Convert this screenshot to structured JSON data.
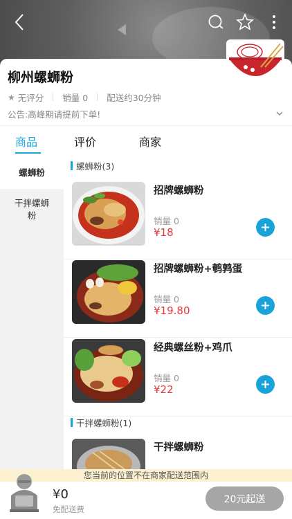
{
  "shop": {
    "name": "柳州螺蛳粉",
    "rating": "无评分",
    "sales": "销量 0",
    "delivery_time": "配送约30分钟",
    "notice": "公告:高峰期请提前下单!"
  },
  "tabs": [
    {
      "label": "商品",
      "active": true
    },
    {
      "label": "评价",
      "active": false
    },
    {
      "label": "商家",
      "active": false
    }
  ],
  "sidebar": {
    "items": [
      {
        "label": "螺蛳粉",
        "active": true
      },
      {
        "label": "干拌螺蛳粉",
        "active": false
      }
    ]
  },
  "sections": [
    {
      "title": "螺蛳粉(3)",
      "products": [
        {
          "name": "招牌螺蛳粉",
          "sales": "销量 0",
          "price": "¥18"
        },
        {
          "name": "招牌螺蛳粉+鹌鹑蛋",
          "sales": "销量 0",
          "price": "¥19.80"
        },
        {
          "name": "经典螺丝粉+鸡爪",
          "sales": "销量 0",
          "price": "¥22"
        }
      ]
    },
    {
      "title": "干拌螺蛳粉(1)",
      "products": [
        {
          "name": "干拌螺蛳粉"
        }
      ]
    }
  ],
  "banner": {
    "text": "您当前的位置不在商家配送范围内"
  },
  "cart": {
    "total": "¥0",
    "delivery_fee": "免配送费",
    "min_order": "20元起送"
  },
  "colors": {
    "accent": "#1aa3d9",
    "price": "#e4393c",
    "banner_bg": "#fbf0cf",
    "disabled_button": "#a6a6a6"
  },
  "icons": [
    "back-icon",
    "search-icon",
    "star-icon",
    "more-icon",
    "chevron-down-icon",
    "add-icon",
    "cart-icon"
  ]
}
